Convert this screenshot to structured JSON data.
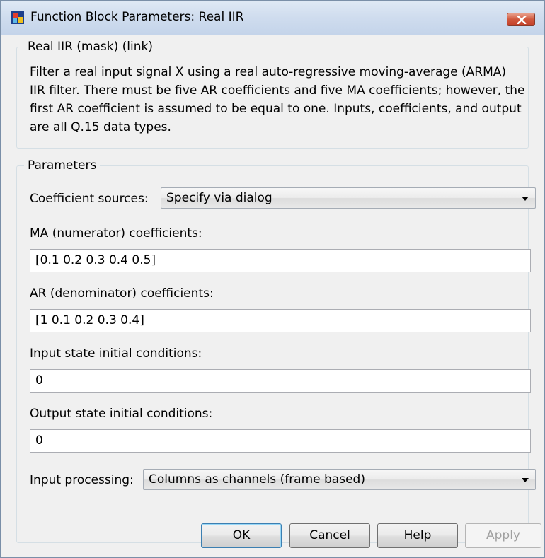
{
  "window": {
    "title": "Function Block Parameters: Real IIR",
    "icon": "simulink-block-icon",
    "close_icon": "close-icon"
  },
  "description": {
    "legend": "Real IIR (mask) (link)",
    "text": "Filter a real input signal X using a real auto-regressive moving-average (ARMA) IIR filter. There must be five AR coefficients and five MA coefficients; however, the first AR coefficient is assumed to be equal to one. Inputs, coefficients, and output are all Q.15 data types."
  },
  "parameters": {
    "legend": "Parameters",
    "coef_source_label": "Coefficient sources:",
    "coef_source_value": "Specify via dialog",
    "ma_label": "MA (numerator) coefficients:",
    "ma_value": "[0.1 0.2 0.3 0.4 0.5]",
    "ar_label": "AR (denominator) coefficients:",
    "ar_value": "[1 0.1 0.2 0.3 0.4]",
    "input_state_label": "Input state initial conditions:",
    "input_state_value": "0",
    "output_state_label": "Output state initial conditions:",
    "output_state_value": "0",
    "input_processing_label": "Input processing:",
    "input_processing_value": "Columns as channels (frame based)"
  },
  "buttons": {
    "ok": "OK",
    "cancel": "Cancel",
    "help": "Help",
    "apply": "Apply"
  }
}
